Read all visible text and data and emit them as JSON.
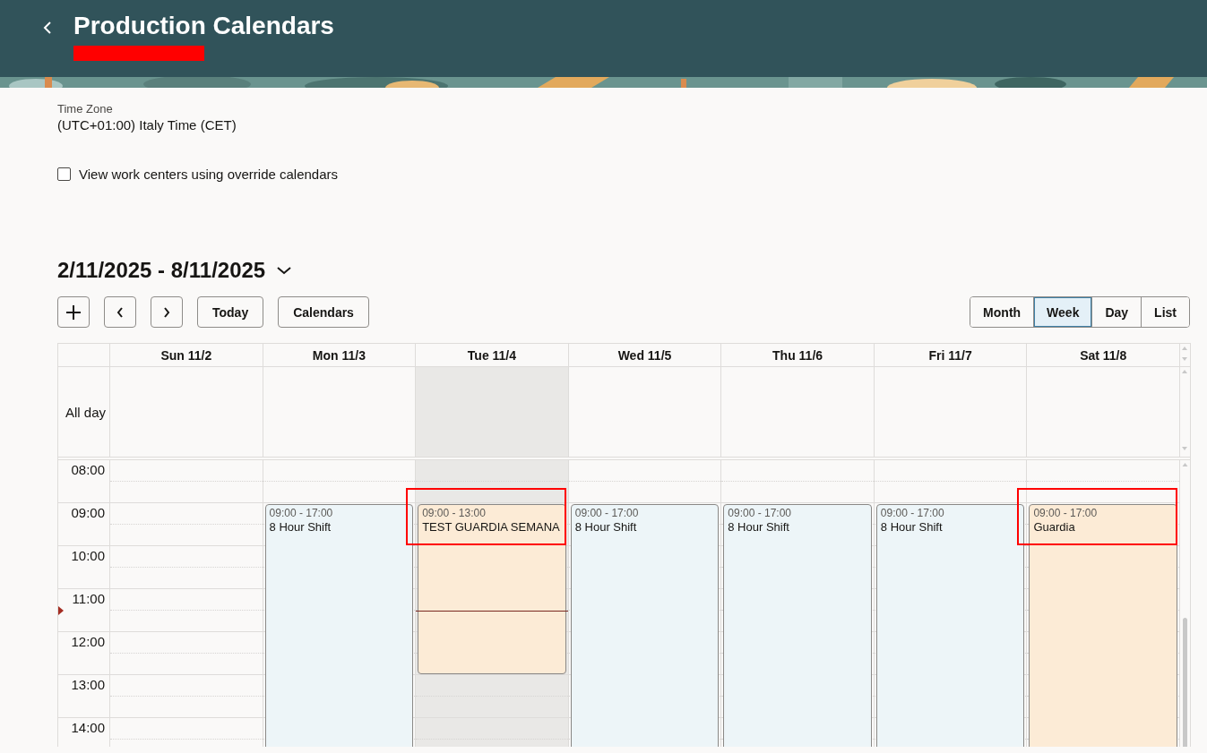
{
  "header": {
    "title": "Production Calendars",
    "redacted": true
  },
  "time_zone": {
    "label": "Time Zone",
    "value": "(UTC+01:00) Italy Time (CET)"
  },
  "override_checkbox": {
    "label": "View work centers using override calendars",
    "checked": false
  },
  "date_range": "2/11/2025 - 8/11/2025",
  "toolbar": [
    {
      "kind": "add"
    },
    {
      "kind": "prev"
    },
    {
      "kind": "next"
    },
    {
      "kind": "text",
      "label": "Today"
    },
    {
      "kind": "text",
      "label": "Calendars"
    }
  ],
  "views": [
    {
      "label": "Month",
      "selected": false
    },
    {
      "label": "Week",
      "selected": true
    },
    {
      "label": "Day",
      "selected": false
    },
    {
      "label": "List",
      "selected": false
    }
  ],
  "calendar": {
    "all_day_label": "All day",
    "hours": [
      {
        "label": "08:00",
        "now": false
      },
      {
        "label": "09:00",
        "now": false
      },
      {
        "label": "10:00",
        "now": false
      },
      {
        "label": "11:00",
        "now": true
      },
      {
        "label": "12:00",
        "now": false
      },
      {
        "label": "13:00",
        "now": false
      },
      {
        "label": "14:00",
        "now": false
      }
    ],
    "days": [
      {
        "label": "Sun 11/2",
        "today": false
      },
      {
        "label": "Mon 11/3",
        "today": false,
        "events": [
          {
            "time": "09:00 - 17:00",
            "title": "8 Hour Shift",
            "color": "#edf5f8",
            "highlighted": false
          }
        ]
      },
      {
        "label": "Tue 11/4",
        "today": true,
        "events": [
          {
            "time": "09:00 - 13:00",
            "title": "TEST GUARDIA SEMANA",
            "color": "#fcebd6",
            "highlighted": true
          }
        ]
      },
      {
        "label": "Wed 11/5",
        "today": false,
        "events": [
          {
            "time": "09:00 - 17:00",
            "title": "8 Hour Shift",
            "color": "#edf5f8",
            "highlighted": false
          }
        ]
      },
      {
        "label": "Thu 11/6",
        "today": false,
        "events": [
          {
            "time": "09:00 - 17:00",
            "title": "8 Hour Shift",
            "color": "#edf5f8",
            "highlighted": false
          }
        ]
      },
      {
        "label": "Fri 11/7",
        "today": false,
        "events": [
          {
            "time": "09:00 - 17:00",
            "title": "8 Hour Shift",
            "color": "#edf5f8",
            "highlighted": false
          }
        ]
      },
      {
        "label": "Sat 11/8",
        "today": false,
        "events": [
          {
            "time": "09:00 - 17:00",
            "title": "Guardia",
            "color": "#fcebd6",
            "highlighted": true
          }
        ]
      }
    ]
  }
}
